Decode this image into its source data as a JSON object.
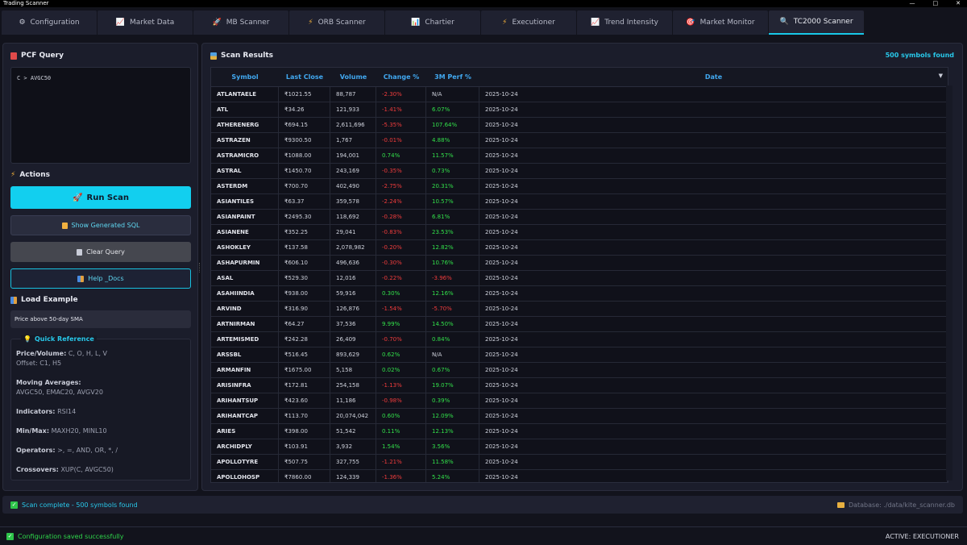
{
  "window": {
    "title": "Trading Scanner"
  },
  "tabs": [
    {
      "label": "Configuration",
      "icon": "gear-icon",
      "glyph": "⚙",
      "color": "#c9ccd8"
    },
    {
      "label": "Market Data",
      "icon": "chart-icon",
      "glyph": "📈",
      "color": "#c9ccd8"
    },
    {
      "label": "MB Scanner",
      "icon": "rocket-icon",
      "glyph": "🚀",
      "color": "#e0507a"
    },
    {
      "label": "ORB Scanner",
      "icon": "lightning-icon",
      "glyph": "⚡",
      "color": "#f4b13a"
    },
    {
      "label": "Chartier",
      "icon": "bar-chart-icon",
      "glyph": "📊",
      "color": "#4fa0e0"
    },
    {
      "label": "Executioner",
      "icon": "lightning-icon",
      "glyph": "⚡",
      "color": "#f4b13a"
    },
    {
      "label": "Trend Intensity",
      "icon": "trend-icon",
      "glyph": "📈",
      "color": "#c9ccd8"
    },
    {
      "label": "Market Monitor",
      "icon": "target-icon",
      "glyph": "🎯",
      "color": "#e0507a"
    },
    {
      "label": "TC2000 Scanner",
      "icon": "magnifier-icon",
      "glyph": "🔍",
      "color": "#4fb6ff"
    }
  ],
  "left": {
    "query_title": "PCF Query",
    "query_text": "C > AVGC50",
    "actions_title": "Actions",
    "run_label": "Run Scan",
    "sql_label": "Show Generated SQL",
    "clear_label": "Clear Query",
    "help_label": "Help _Docs",
    "load_title": "Load Example",
    "example_value": "Price above 50-day SMA",
    "qref_title": "Quick Reference",
    "qref": {
      "price_label": "Price/Volume:",
      "price_value": "C, O, H, L, V",
      "offset": "Offset: C1, H5",
      "ma_label": "Moving Averages:",
      "ma_value": "AVGC50, EMAC20, AVGV20",
      "ind_label": "Indicators:",
      "ind_value": "RSI14",
      "mm_label": "Min/Max:",
      "mm_value": "MAXH20, MINL10",
      "op_label": "Operators:",
      "op_value": ">, =, AND, OR, *, /",
      "cross_label": "Crossovers:",
      "cross_value": "XUP(C, AVGC50)"
    }
  },
  "results": {
    "title": "Scan Results",
    "count": "500 symbols found",
    "columns": [
      "Symbol",
      "Last Close",
      "Volume",
      "Change %",
      "3M Perf %",
      "Date"
    ],
    "rows": [
      [
        "ATLANTAELE",
        "₹1021.55",
        "88,787",
        "-2.30%",
        "N/A",
        "2025-10-24"
      ],
      [
        "ATL",
        "₹34.26",
        "121,933",
        "-1.41%",
        "6.07%",
        "2025-10-24"
      ],
      [
        "ATHERENERG",
        "₹694.15",
        "2,611,696",
        "-5.35%",
        "107.64%",
        "2025-10-24"
      ],
      [
        "ASTRAZEN",
        "₹9300.50",
        "1,767",
        "-0.01%",
        "4.88%",
        "2025-10-24"
      ],
      [
        "ASTRAMICRO",
        "₹1088.00",
        "194,001",
        "0.74%",
        "11.57%",
        "2025-10-24"
      ],
      [
        "ASTRAL",
        "₹1450.70",
        "243,169",
        "-0.35%",
        "0.73%",
        "2025-10-24"
      ],
      [
        "ASTERDM",
        "₹700.70",
        "402,490",
        "-2.75%",
        "20.31%",
        "2025-10-24"
      ],
      [
        "ASIANTILES",
        "₹63.37",
        "359,578",
        "-2.24%",
        "10.57%",
        "2025-10-24"
      ],
      [
        "ASIANPAINT",
        "₹2495.30",
        "118,692",
        "-0.28%",
        "6.81%",
        "2025-10-24"
      ],
      [
        "ASIANENE",
        "₹352.25",
        "29,041",
        "-0.83%",
        "23.53%",
        "2025-10-24"
      ],
      [
        "ASHOKLEY",
        "₹137.58",
        "2,078,982",
        "-0.20%",
        "12.82%",
        "2025-10-24"
      ],
      [
        "ASHAPURMIN",
        "₹606.10",
        "496,636",
        "-0.30%",
        "10.76%",
        "2025-10-24"
      ],
      [
        "ASAL",
        "₹529.30",
        "12,016",
        "-0.22%",
        "-3.96%",
        "2025-10-24"
      ],
      [
        "ASAHIINDIA",
        "₹938.00",
        "59,916",
        "0.30%",
        "12.16%",
        "2025-10-24"
      ],
      [
        "ARVIND",
        "₹316.90",
        "126,876",
        "-1.54%",
        "-5.70%",
        "2025-10-24"
      ],
      [
        "ARTNIRMAN",
        "₹64.27",
        "37,536",
        "9.99%",
        "14.50%",
        "2025-10-24"
      ],
      [
        "ARTEMISMED",
        "₹242.28",
        "26,409",
        "-0.70%",
        "0.84%",
        "2025-10-24"
      ],
      [
        "ARSSBL",
        "₹516.45",
        "893,629",
        "0.62%",
        "N/A",
        "2025-10-24"
      ],
      [
        "ARMANFIN",
        "₹1675.00",
        "5,158",
        "0.02%",
        "0.67%",
        "2025-10-24"
      ],
      [
        "ARISINFRA",
        "₹172.81",
        "254,158",
        "-1.13%",
        "19.07%",
        "2025-10-24"
      ],
      [
        "ARIHANTSUP",
        "₹423.60",
        "11,186",
        "-0.98%",
        "0.39%",
        "2025-10-24"
      ],
      [
        "ARIHANTCAP",
        "₹113.70",
        "20,074,042",
        "0.60%",
        "12.09%",
        "2025-10-24"
      ],
      [
        "ARIES",
        "₹398.00",
        "51,542",
        "0.11%",
        "12.13%",
        "2025-10-24"
      ],
      [
        "ARCHIDPLY",
        "₹103.91",
        "3,932",
        "1.54%",
        "3.56%",
        "2025-10-24"
      ],
      [
        "APOLLOTYRE",
        "₹507.75",
        "327,755",
        "-1.21%",
        "11.58%",
        "2025-10-24"
      ],
      [
        "APOLLOHOSP",
        "₹7860.00",
        "124,339",
        "-1.36%",
        "5.24%",
        "2025-10-24"
      ]
    ]
  },
  "status": {
    "scan_message": "Scan complete - 500 symbols found",
    "database": "Database: ./data/kite_scanner.db",
    "config_message": "Configuration saved successfully",
    "active": "ACTIVE: EXECUTIONER"
  },
  "colors": {
    "accent": "#18c8e8",
    "positive": "#32e04a",
    "negative": "#f03c3c"
  }
}
